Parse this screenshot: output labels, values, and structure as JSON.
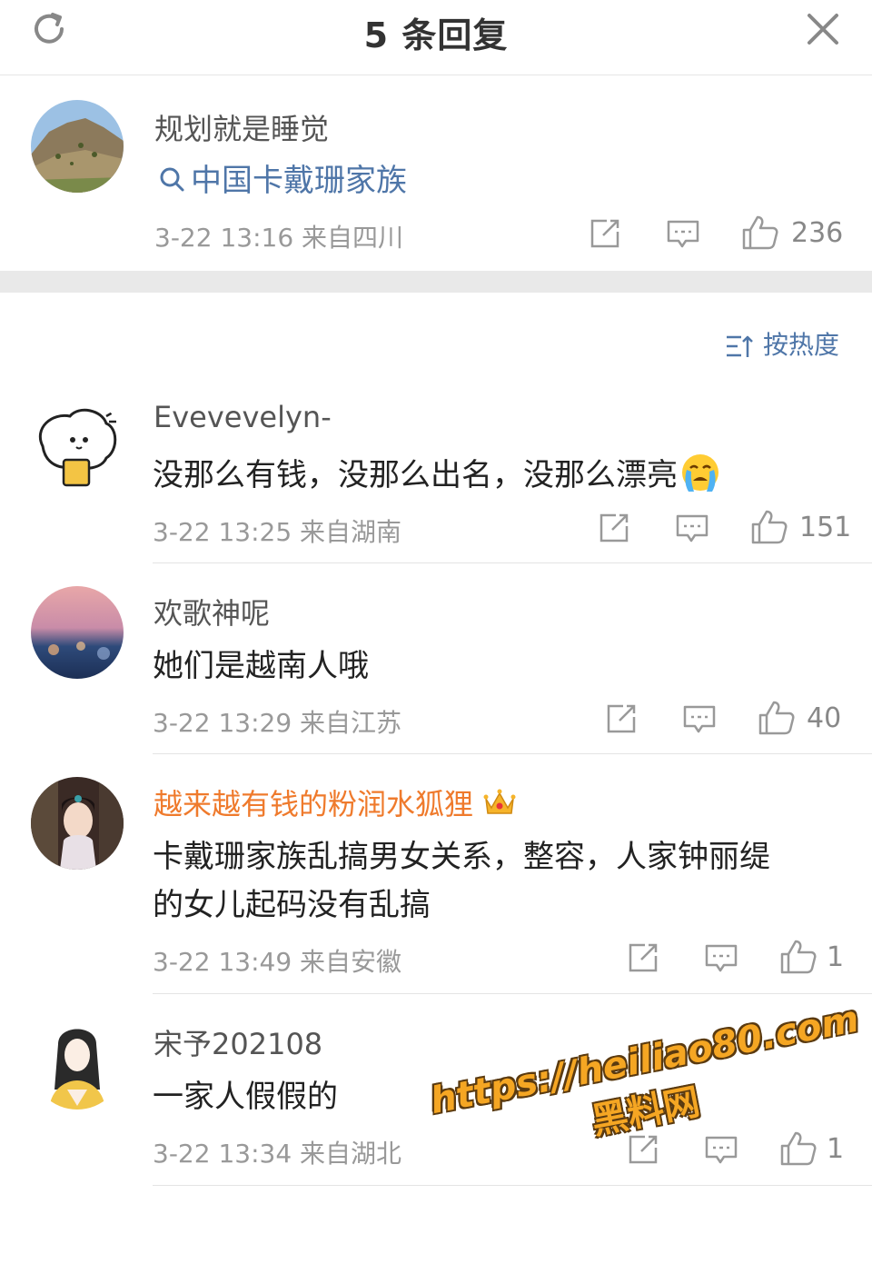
{
  "header": {
    "title": "5 条回复",
    "refresh_icon": "refresh-icon",
    "close_icon": "close-icon"
  },
  "root": {
    "username": "规划就是睡觉",
    "topic": "中国卡戴珊家族",
    "meta": "3-22 13:16  来自四川",
    "likes": "236"
  },
  "sort": {
    "label": "按热度"
  },
  "replies": [
    {
      "username": "Evevevelyn-",
      "text": "没那么有钱，没那么出名，没那么漂亮",
      "meta": "3-22 13:25  来自湖南",
      "likes": "151"
    },
    {
      "username": "欢歌神呢",
      "text": "她们是越南人哦",
      "meta": "3-22 13:29  来自江苏",
      "likes": "40"
    },
    {
      "username": "越来越有钱的粉润水狐狸",
      "text_line1": "卡戴珊家族乱搞男女关系，整容，人家钟丽缇",
      "text_line2": "的女儿起码没有乱搞",
      "meta": "3-22 13:49  来自安徽",
      "likes": "1"
    },
    {
      "username": "宋予202108",
      "text": "一家人假假的",
      "meta": "3-22 13:34  来自湖北",
      "likes": "1"
    }
  ],
  "watermark": {
    "url": "https://heiliao80.com",
    "name": "黑料网"
  },
  "colors": {
    "link": "#4f76a8",
    "vip_name": "#ef7a2c",
    "meta": "#999999"
  }
}
